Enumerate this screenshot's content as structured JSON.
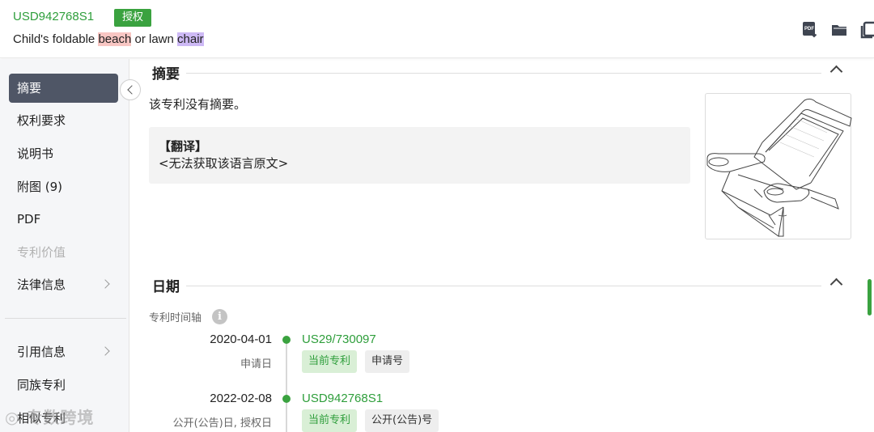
{
  "header": {
    "patent_number": "USD942768S1",
    "status_badge": "授权",
    "title_parts": [
      "Child's foldable ",
      "beach",
      " or lawn ",
      "chair"
    ],
    "tools": [
      "pdf-download-icon",
      "folder-icon",
      "copy-icon"
    ]
  },
  "sidebar": {
    "items": [
      {
        "label": "摘要",
        "active": true
      },
      {
        "label": "权利要求"
      },
      {
        "label": "说明书"
      },
      {
        "label": "附图 (9)"
      },
      {
        "label": "PDF"
      },
      {
        "label": "专利价值",
        "disabled": true
      },
      {
        "label": "法律信息",
        "has_arrow": true
      },
      {
        "label": "引用信息",
        "has_arrow": true
      },
      {
        "label": "同族专利"
      },
      {
        "label": "相似专利"
      }
    ]
  },
  "abstract": {
    "heading": "摘要",
    "text": "该专利没有摘要。",
    "translation_title": "【翻译】",
    "translation_text": "<无法获取该语言原文>"
  },
  "dates": {
    "heading": "日期",
    "timeline_label": "专利时间轴",
    "entries": [
      {
        "date": "2020-04-01",
        "type": "申请日",
        "number": "US29/730097",
        "tags": [
          "当前专利",
          "申请号"
        ]
      },
      {
        "date": "2022-02-08",
        "type": "公开(公告)日, 授权日",
        "number": "USD942768S1",
        "tags": [
          "当前专利",
          "公开(公告)号"
        ]
      }
    ]
  },
  "watermark": "专数跨境",
  "colors": {
    "accent": "#3aa23f",
    "nav_active": "#4f5666",
    "highlight_red": "#f8c6c3",
    "highlight_purple": "#cdb9f5"
  }
}
